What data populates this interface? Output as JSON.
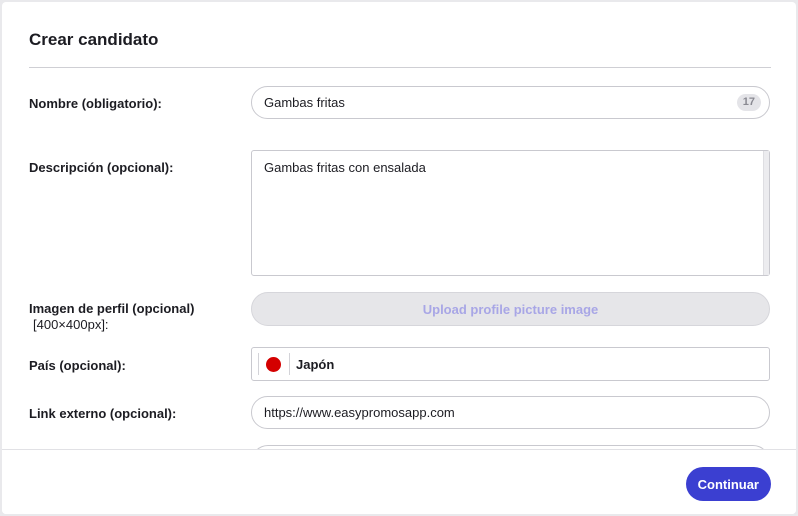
{
  "modal": {
    "title": "Crear candidato"
  },
  "form": {
    "name": {
      "label": "Nombre (obligatorio):",
      "value": "Gambas fritas",
      "counter": "17"
    },
    "description": {
      "label": "Descripción (opcional):",
      "value": "Gambas fritas con ensalada"
    },
    "profile_image": {
      "label": "Imagen de perfil (opcional)",
      "size_hint": "[400×400px]:",
      "button_label": "Upload profile picture image"
    },
    "country": {
      "label": "País (opcional):",
      "value": "Japón",
      "flag_color": "#d40000"
    },
    "external_link": {
      "label": "Link externo (opcional):",
      "value": "https://www.easypromosapp.com"
    }
  },
  "footer": {
    "continue_label": "Continuar"
  },
  "colors": {
    "primary": "#3b3fd1",
    "upload_text": "#a8a6e6"
  }
}
